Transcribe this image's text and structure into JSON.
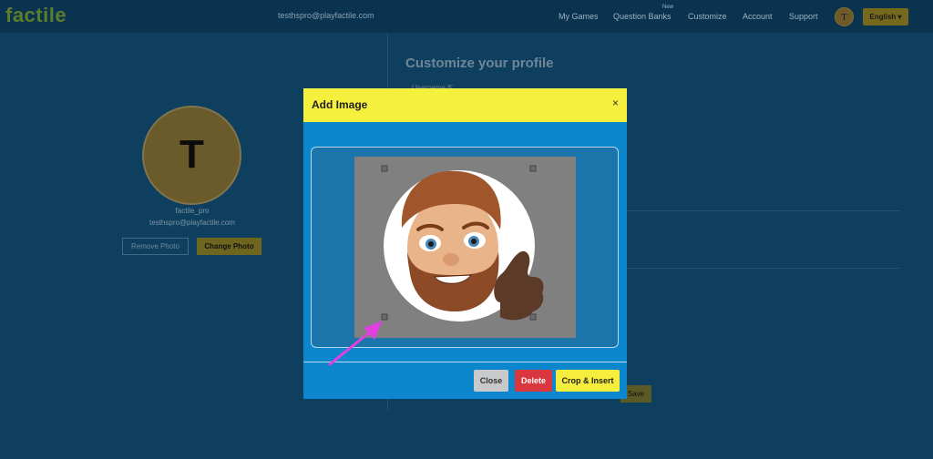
{
  "nav": {
    "logo": "factile",
    "email": "testhspro@playfactile.com",
    "links": [
      "My Games",
      "Question Banks",
      "Customize",
      "Account",
      "Support"
    ],
    "new_badge": "New",
    "avatar_letter": "T",
    "language": "English"
  },
  "profile": {
    "avatar_letter": "T",
    "username": "factile_pro",
    "email": "testhspro@playfactile.com",
    "remove_label": "Remove Photo",
    "change_label": "Change Photo"
  },
  "settings": {
    "heading": "Customize your profile",
    "username_label": "Username",
    "save_label": "Save"
  },
  "modal": {
    "title": "Add Image",
    "close_glyph": "×",
    "buttons": {
      "close": "Close",
      "delete": "Delete",
      "crop": "Crop & Insert"
    }
  },
  "colors": {
    "page_bg": "#0f3f5e",
    "modal_body": "#0c86cc",
    "modal_header": "#f5f03e",
    "delete": "#d9363e",
    "annotation_arrow": "#e040e0"
  },
  "icons": [
    "external-link-icon",
    "chevron-down-icon",
    "close-icon",
    "annotation-arrow-icon"
  ]
}
